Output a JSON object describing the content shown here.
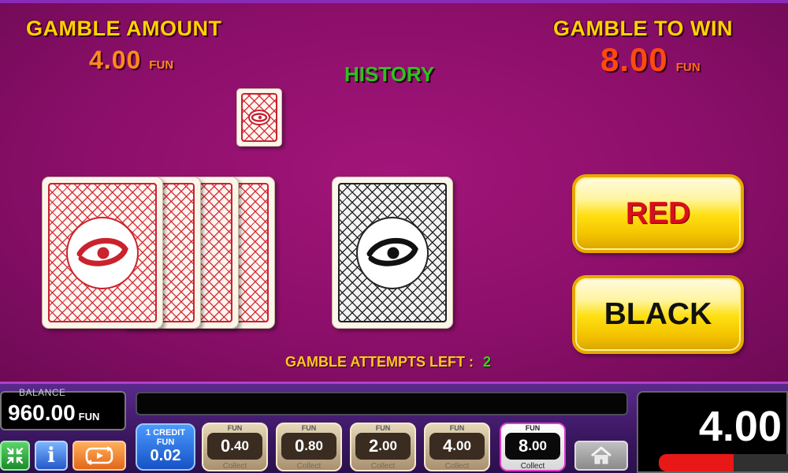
{
  "gamble": {
    "amount_label": "GAMBLE AMOUNT",
    "amount_int": "4",
    "amount_dec": ".00",
    "to_win_label": "GAMBLE TO WIN",
    "to_win_int": "8",
    "to_win_dec": ".00",
    "currency": "FUN",
    "history_label": "HISTORY",
    "red_label": "RED",
    "black_label": "BLACK",
    "attempts_label": "GAMBLE ATTEMPTS LEFT :",
    "attempts_left": "2"
  },
  "history": [
    "red"
  ],
  "bottom": {
    "balance_label": "BALANCE",
    "balance_value": "960.00",
    "balance_currency": "FUN",
    "credit_label": "1 CREDIT",
    "credit_currency": "FUN",
    "credit_value": "0.02",
    "info_icon_glyph": "i",
    "bets": [
      {
        "currency": "FUN",
        "int": "0",
        "dec": ".40",
        "label": "Collect",
        "active": false
      },
      {
        "currency": "FUN",
        "int": "0",
        "dec": ".80",
        "label": "Collect",
        "active": false
      },
      {
        "currency": "FUN",
        "int": "2",
        "dec": ".00",
        "label": "Collect",
        "active": false
      },
      {
        "currency": "FUN",
        "int": "4",
        "dec": ".00",
        "label": "Collect",
        "active": false
      },
      {
        "currency": "FUN",
        "int": "8",
        "dec": ".00",
        "label": "Collect",
        "active": true
      }
    ],
    "win_value": "4.00",
    "progress_fraction": 0.57
  },
  "icons": {
    "fullscreen": "fullscreen-icon",
    "info": "info-icon",
    "autoplay": "autoplay-icon",
    "home": "home-icon",
    "card_emblem": "eye-emblem-icon"
  },
  "colors": {
    "background": "#8c0f6a",
    "header_yellow": "#ffd200",
    "amount_orange": "#ff8a1c",
    "win_orange": "#ff4a0e",
    "history_green": "#2ec21e",
    "red_text": "#d8101c",
    "attempts_green": "#36d61e",
    "progress_red": "#e81818"
  }
}
